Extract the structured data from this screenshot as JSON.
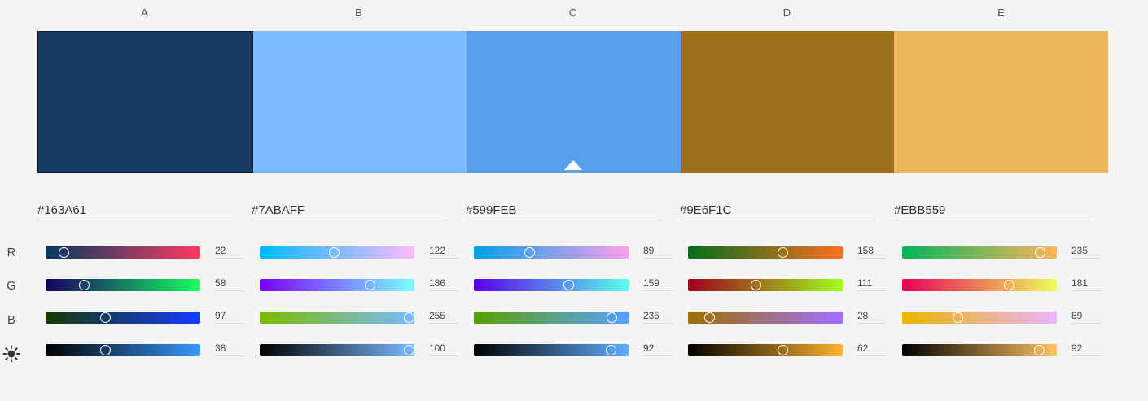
{
  "columns": [
    {
      "label": "A",
      "hex": "#163A61",
      "r": 22,
      "g": 58,
      "b": 97,
      "brightness": 38
    },
    {
      "label": "B",
      "hex": "#7ABAFF",
      "r": 122,
      "g": 186,
      "b": 255,
      "brightness": 100
    },
    {
      "label": "C",
      "hex": "#599FEB",
      "r": 89,
      "g": 159,
      "b": 235,
      "brightness": 92
    },
    {
      "label": "D",
      "hex": "#9E6F1C",
      "r": 158,
      "g": 111,
      "b": 28,
      "brightness": 62
    },
    {
      "label": "E",
      "hex": "#EBB559",
      "r": 235,
      "g": 181,
      "b": 89,
      "brightness": 92
    }
  ],
  "selected_column": 2,
  "outlined_column": 0,
  "row_labels": {
    "r": "R",
    "g": "G",
    "b": "B",
    "brightness_icon": "sun-icon"
  }
}
